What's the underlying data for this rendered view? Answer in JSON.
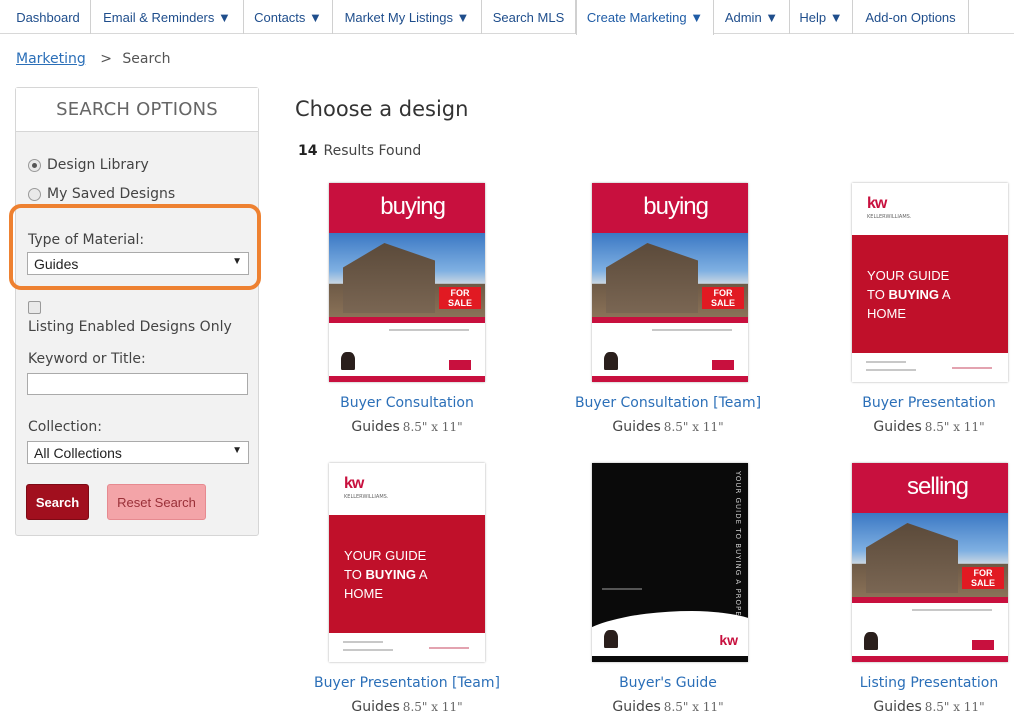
{
  "nav": {
    "items": [
      {
        "label": "Dashboard"
      },
      {
        "label": "Email & Reminders ▼"
      },
      {
        "label": "Contacts ▼"
      },
      {
        "label": "Market My Listings ▼"
      },
      {
        "label": "Search MLS"
      },
      {
        "label": "Create Marketing ▼"
      },
      {
        "label": "Admin ▼"
      },
      {
        "label": "Help ▼"
      },
      {
        "label": "Add-on Options"
      }
    ],
    "active_index": 5
  },
  "breadcrumb": {
    "link": "Marketing",
    "separator": ">",
    "current": "Search"
  },
  "sidebar": {
    "title": "SEARCH OPTIONS",
    "radio_design_library": "Design Library",
    "radio_saved_designs": "My Saved Designs",
    "selected_radio": "Design Library",
    "type_label": "Type of Material:",
    "type_value": "Guides",
    "listing_enabled_label": "Listing Enabled Designs Only",
    "listing_enabled_checked": false,
    "keyword_label": "Keyword or Title:",
    "keyword_value": "",
    "collection_label": "Collection:",
    "collection_value": "All Collections",
    "search_button": "Search",
    "reset_button": "Reset Search",
    "highlight_color": "#ee8131"
  },
  "main": {
    "heading": "Choose a design",
    "results_count": "14",
    "results_label": "Results Found",
    "cards": [
      {
        "title": "Buyer Consultation",
        "type": "Guides",
        "size": "8.5\" x 11\"",
        "thumb": "buying-cover"
      },
      {
        "title": "Buyer Consultation [Team]",
        "type": "Guides",
        "size": "8.5\" x 11\"",
        "thumb": "buying-cover"
      },
      {
        "title": "Buyer Presentation",
        "type": "Guides",
        "size": "8.5\" x 11\"",
        "thumb": "kw-guide-cover"
      },
      {
        "title": "Buyer Presentation [Team]",
        "type": "Guides",
        "size": "8.5\" x 11\"",
        "thumb": "kw-guide-cover"
      },
      {
        "title": "Buyer's Guide",
        "type": "Guides",
        "size": "8.5\" x 11\"",
        "thumb": "black-guide-cover"
      },
      {
        "title": "Listing Presentation",
        "type": "Guides",
        "size": "8.5\" x 11\"",
        "thumb": "selling-cover"
      }
    ]
  },
  "thumb_text": {
    "buying_word": "buying",
    "selling_word": "selling",
    "for_sale": "FOR SALE",
    "kw": "kw",
    "kw_sub": "KELLERWILLIAMS.",
    "guide_line1": "YOUR GUIDE",
    "guide_line2_pre": "TO ",
    "guide_line2_bold": "BUYING",
    "guide_line2_post": " A",
    "guide_line3": "HOME",
    "vertical_text": "YOUR GUIDE TO BUYING A PROPERTY"
  },
  "colors": {
    "brand_red": "#c8103e",
    "link_blue": "#2b6fb8",
    "search_button": "#a10f1e",
    "reset_button": "#f3a4a8"
  }
}
